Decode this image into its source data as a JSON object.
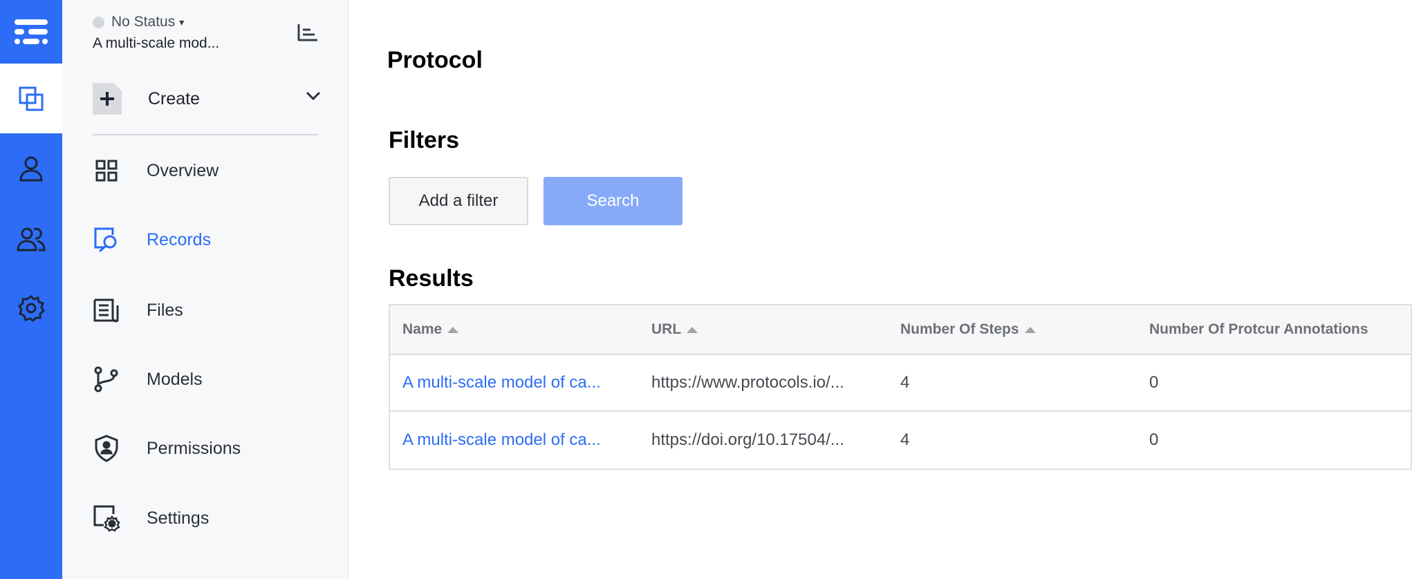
{
  "dataset": {
    "status": "No Status",
    "name": "A multi-scale mod..."
  },
  "sidebar": {
    "create_label": "Create",
    "items": [
      {
        "label": "Overview",
        "icon": "grid-icon",
        "active": false
      },
      {
        "label": "Records",
        "icon": "records-search-icon",
        "active": true
      },
      {
        "label": "Files",
        "icon": "files-icon",
        "active": false
      },
      {
        "label": "Models",
        "icon": "models-branch-icon",
        "active": false
      },
      {
        "label": "Permissions",
        "icon": "shield-icon",
        "active": false
      },
      {
        "label": "Settings",
        "icon": "settings-icon",
        "active": false
      }
    ]
  },
  "rail": {
    "items": [
      "logo-icon",
      "datasets-icon",
      "user-icon",
      "team-icon",
      "gear-icon"
    ]
  },
  "main": {
    "title": "Protocol",
    "filters_heading": "Filters",
    "add_filter_label": "Add a filter",
    "search_label": "Search",
    "results_heading": "Results"
  },
  "table": {
    "headers": [
      "Name",
      "URL",
      "Number Of Steps",
      "Number Of Protcur Annotations"
    ],
    "rows": [
      [
        "A multi-scale model of ca...",
        "https://www.protocols.io/...",
        "4",
        "0"
      ],
      [
        "A multi-scale model of ca...",
        "https://doi.org/10.17504/...",
        "4",
        "0"
      ]
    ]
  },
  "colors": {
    "accent": "#2c6cf6",
    "search_button": "#86aaf8"
  }
}
